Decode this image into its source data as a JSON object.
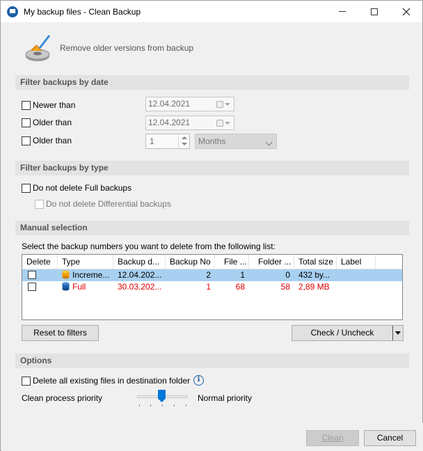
{
  "window": {
    "title": "My backup files - Clean Backup"
  },
  "header": {
    "text": "Remove older versions from backup",
    "icon": "broom-disk-icon"
  },
  "filter_date": {
    "section_title": "Filter backups by date",
    "newer_than": {
      "label": "Newer than",
      "checked": false,
      "date": "12.04.2021"
    },
    "older_than": {
      "label": "Older than",
      "checked": false,
      "date": "12.04.2021"
    },
    "older_than_units": {
      "label": "Older than",
      "checked": false,
      "value": "1",
      "unit": "Months"
    }
  },
  "filter_type": {
    "section_title": "Filter backups by type",
    "no_full": {
      "label": "Do not delete Full backups",
      "checked": false
    },
    "no_diff": {
      "label": "Do not delete Differential backups",
      "checked": false
    }
  },
  "manual": {
    "section_title": "Manual selection",
    "instruction": "Select the backup numbers you want to delete from the following list:",
    "columns": [
      "Delete",
      "Type",
      "Backup d...",
      "Backup No",
      "File ...",
      "Folder ...",
      "Total size",
      "Label"
    ],
    "rows": [
      {
        "delete": false,
        "type": "Increme...",
        "date": "12.04.202...",
        "no": "2",
        "files": "1",
        "folders": "0",
        "size": "432 by...",
        "label": "",
        "selected": true,
        "color": "#000000",
        "icon_color": "#f0a000"
      },
      {
        "delete": false,
        "type": "Full",
        "date": "30.03.202...",
        "no": "1",
        "files": "68",
        "folders": "58",
        "size": "2,89 MB",
        "label": "",
        "selected": false,
        "color": "#e00000",
        "icon_color": "#2060b0"
      }
    ],
    "reset_button": "Reset to filters",
    "check_button": "Check / Uncheck"
  },
  "options": {
    "section_title": "Options",
    "delete_existing": {
      "label": "Delete all existing files in destination folder",
      "checked": false
    },
    "priority_label": "Clean process priority",
    "priority_value": "Normal priority"
  },
  "footer": {
    "clean_button": "Clean",
    "cancel_button": "Cancel"
  }
}
